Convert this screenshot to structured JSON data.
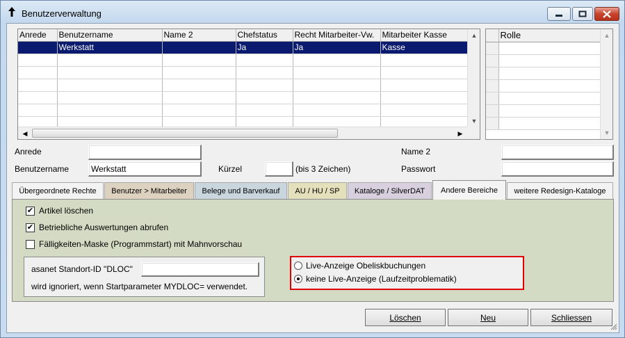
{
  "window": {
    "title": "Benutzerverwaltung"
  },
  "users_grid": {
    "columns": [
      "Anrede",
      "Benutzername",
      "Name 2",
      "Chefstatus",
      "Recht Mitarbeiter-Vw.",
      "Mitarbeiter Kasse"
    ],
    "rows": [
      [
        "",
        "Werkstatt",
        "",
        "Ja",
        "Ja",
        "Kasse"
      ]
    ]
  },
  "roles_grid": {
    "column": "Rolle"
  },
  "form": {
    "anrede_label": "Anrede",
    "anrede_value": "",
    "benutzername_label": "Benutzername",
    "benutzername_value": "Werkstatt",
    "kuerzel_label": "Kürzel",
    "kuerzel_value": "",
    "kuerzel_hint": "(bis 3 Zeichen)",
    "name2_label": "Name 2",
    "name2_value": "",
    "passwort_label": "Passwort",
    "passwort_value": ""
  },
  "tabs": [
    {
      "label": "Übergeordnete Rechte",
      "color": "#f3f3f3"
    },
    {
      "label": "Benutzer > Mitarbeiter",
      "color": "#ddd2bf"
    },
    {
      "label": "Belege und Barverkauf",
      "color": "#c9d6dd"
    },
    {
      "label": "AU / HU / SP",
      "color": "#e4e0bc"
    },
    {
      "label": "Kataloge / SilverDAT",
      "color": "#d8d0df"
    },
    {
      "label": "Andere Bereiche",
      "color": "#f4f4f4",
      "active": true
    },
    {
      "label": "weitere Redesign-Kataloge",
      "color": "#f3f3f3"
    }
  ],
  "panel": {
    "color": "#d3dbc4",
    "checkboxes": [
      {
        "label": "Artikel löschen",
        "checked": true
      },
      {
        "label": "Betriebliche Auswertungen abrufen",
        "checked": true
      },
      {
        "label": "Fälligkeiten-Maske (Programmstart) mit Mahnvorschau",
        "checked": false
      }
    ],
    "standort_label": "asanet Standort-ID \"DLOC\"",
    "standort_value": "",
    "standort_note": "wird ignoriert, wenn Startparameter MYDLOC= verwendet.",
    "radios": [
      {
        "label": "Live-Anzeige Obeliskbuchungen",
        "selected": false
      },
      {
        "label": "keine Live-Anzeige (Laufzeitproblematik)",
        "selected": true
      }
    ],
    "highlight_color": "#e30000"
  },
  "buttons": {
    "delete": "Löschen",
    "new": "Neu",
    "close": "Schliessen"
  },
  "icons": {
    "title": "arrow-up-icon",
    "minimize": "minimize-icon",
    "maximize": "maximize-icon",
    "close": "close-icon"
  }
}
